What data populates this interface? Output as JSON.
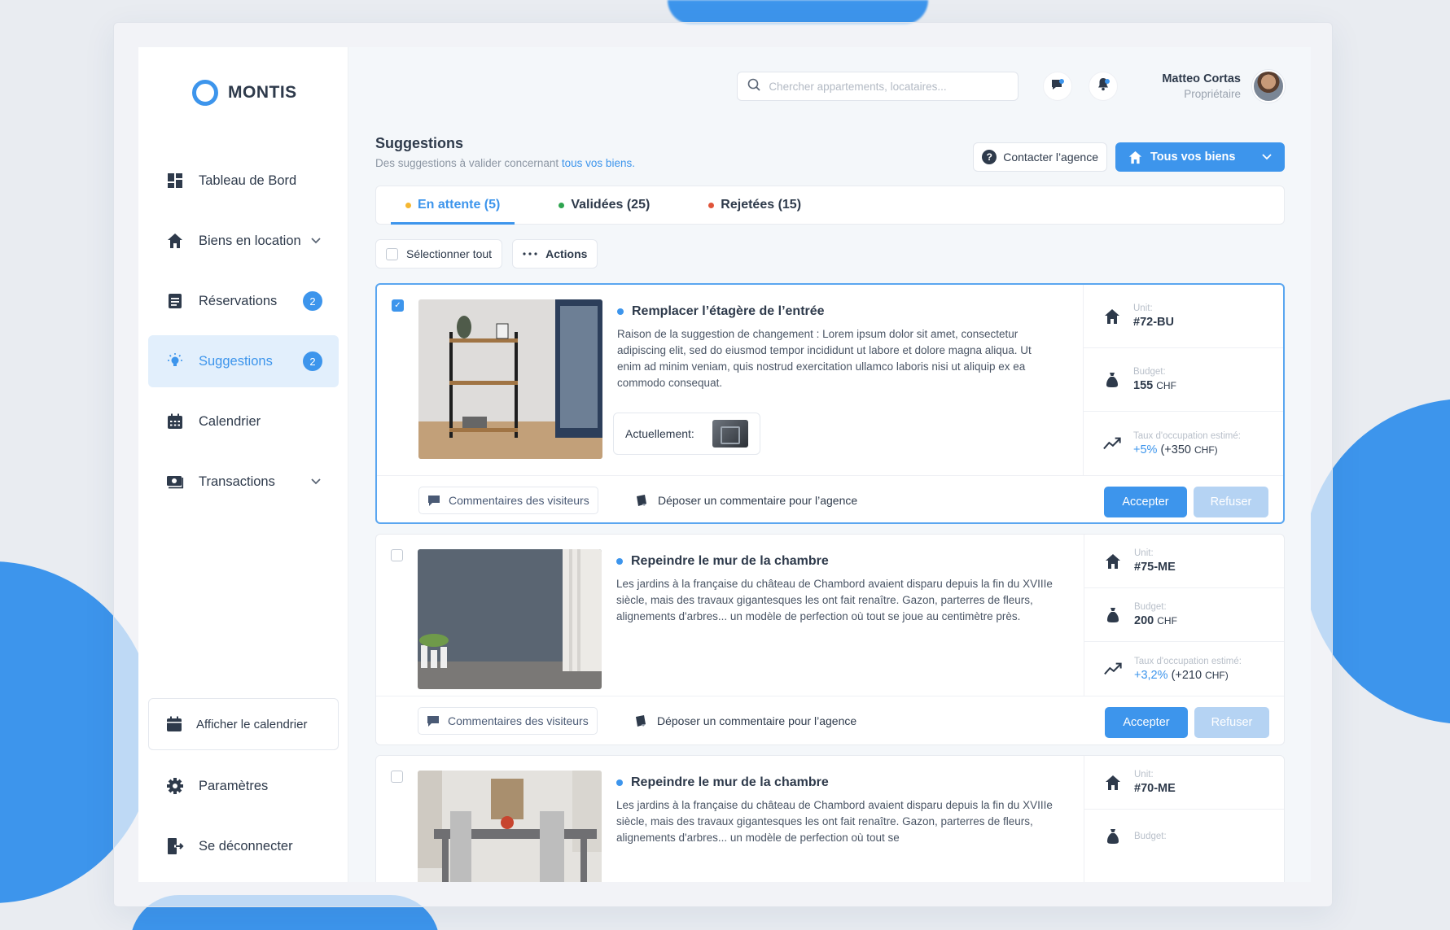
{
  "brand": {
    "name": "MONTIS",
    "accent": "#3d95ec"
  },
  "sidebar": {
    "items": [
      {
        "label": "Tableau de Bord",
        "icon": "dashboard-icon"
      },
      {
        "label": "Biens en location",
        "icon": "home-icon",
        "has_chevron": true
      },
      {
        "label": "Réservations",
        "icon": "list-icon",
        "badge": "2"
      },
      {
        "label": "Suggestions",
        "icon": "lightbulb-icon",
        "badge": "2",
        "active": true
      },
      {
        "label": "Calendrier",
        "icon": "calendar-icon"
      },
      {
        "label": "Transactions",
        "icon": "money-icon",
        "has_chevron": true
      }
    ],
    "calendar_button": "Afficher le calendrier",
    "settings": "Paramètres",
    "logout": "Se déconnecter"
  },
  "topbar": {
    "search_placeholder": "Chercher appartements, locataires...",
    "user_name": "Matteo Cortas",
    "user_role": "Propriétaire"
  },
  "page": {
    "title": "Suggestions",
    "subtitle_prefix": "Des suggestions à valider concernant",
    "subtitle_link": "tous vos biens.",
    "contact_button": "Contacter l’agence",
    "properties_button": "Tous vos biens"
  },
  "tabs": [
    {
      "label": "En attente (5)",
      "color": "#f5b731",
      "active": true
    },
    {
      "label": "Validées (25)",
      "color": "#2ea44f"
    },
    {
      "label": "Rejetées (15)",
      "color": "#e0543a"
    }
  ],
  "toolbar": {
    "select_all": "Sélectionner tout",
    "actions": "Actions"
  },
  "cards": [
    {
      "selected": true,
      "title": "Remplacer l’étagère de l’entrée",
      "description": "Raison de la suggestion de changement : Lorem ipsum dolor sit amet, consectetur adipiscing elit, sed do eiusmod tempor incididunt ut labore et dolore magna aliqua. Ut enim ad minim veniam, quis nostrud exercitation ullamco laboris nisi ut aliquip ex ea commodo consequat.",
      "current_label": "Actuellement:",
      "unit_label": "Unit:",
      "unit": "#72-BU",
      "budget_label": "Budget:",
      "budget": "155",
      "currency": "CHF",
      "occupancy_label": "Taux d'occupation estimé:",
      "occupancy_pct": "+5%",
      "occupancy_amt": "(+350",
      "occupancy_cur": "CHF)",
      "comments": "Commentaires des visiteurs",
      "deposit": "Déposer un commentaire pour l’agence",
      "accept": "Accepter",
      "refuse": "Refuser"
    },
    {
      "selected": false,
      "title": "Repeindre le mur de la chambre",
      "description": "Les jardins à la française du château de Chambord avaient disparu depuis la fin du XVIIIe siècle, mais des travaux gigantesques les ont fait renaître. Gazon, parterres de fleurs, alignements d'arbres... un modèle de perfection où tout se joue au centimètre près.",
      "unit_label": "Unit:",
      "unit": "#75-ME",
      "budget_label": "Budget:",
      "budget": "200",
      "currency": "CHF",
      "occupancy_label": "Taux d'occupation estimé:",
      "occupancy_pct": "+3,2%",
      "occupancy_amt": "(+210",
      "occupancy_cur": "CHF)",
      "comments": "Commentaires des visiteurs",
      "deposit": "Déposer un commentaire pour l’agence",
      "accept": "Accepter",
      "refuse": "Refuser"
    },
    {
      "selected": false,
      "title": "Repeindre le mur de la chambre",
      "description": "Les jardins à la française du château de Chambord avaient disparu depuis la fin du XVIIIe siècle, mais des travaux gigantesques les ont fait renaître. Gazon, parterres de fleurs, alignements d'arbres... un modèle de perfection où tout se",
      "unit_label": "Unit:",
      "unit": "#70-ME",
      "budget_label": "Budget:"
    }
  ]
}
